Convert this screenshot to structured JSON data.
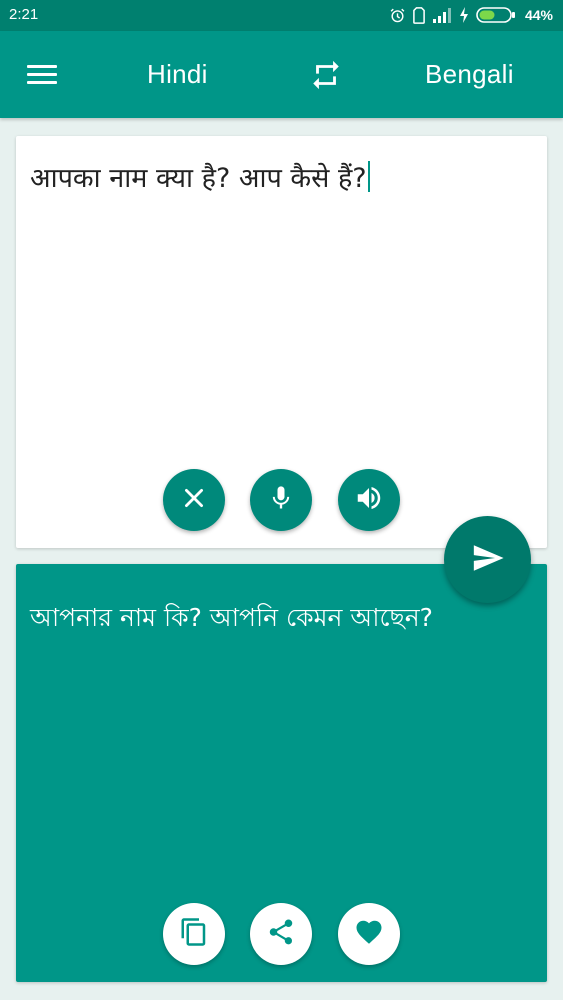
{
  "status_bar": {
    "time": "2:21",
    "battery_percent": "44%",
    "icons": [
      "alarm-icon",
      "sim-icon",
      "signal-icon",
      "charging-icon",
      "battery-icon"
    ]
  },
  "app_bar": {
    "source_language": "Hindi",
    "target_language": "Bengali",
    "menu_icon": "menu-icon",
    "swap_icon": "swap-icon"
  },
  "input": {
    "text": "आपका नाम क्या है? आप कैसे हैं?",
    "buttons": [
      "clear-icon",
      "mic-icon",
      "speaker-icon"
    ]
  },
  "send_icon": "send-icon",
  "output": {
    "text": "আপনার নাম কি? আপনি কেমন আছেন?",
    "buttons": [
      "copy-icon",
      "share-icon",
      "favorite-icon"
    ]
  },
  "colors": {
    "status_bar": "#00806f",
    "primary": "#009688",
    "accent_dark": "#00796b",
    "background": "#e7f1ef"
  }
}
